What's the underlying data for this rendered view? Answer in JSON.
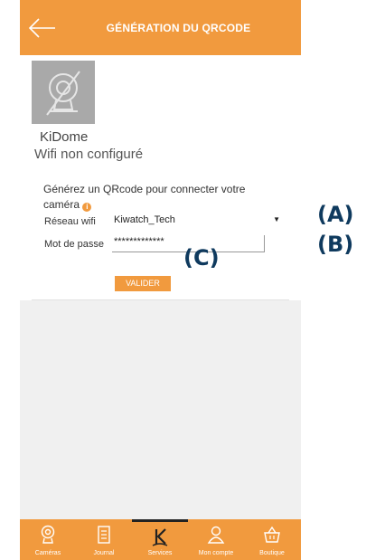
{
  "header": {
    "title": "GÉNÉRATION DU QRCODE"
  },
  "device": {
    "name": "KiDome",
    "status": "Wifi non configuré"
  },
  "form": {
    "prompt": "Générez un QRcode pour connecter votre caméra",
    "wifi_label": "Réseau wifi",
    "wifi_value": "Kiwatch_Tech",
    "password_label": "Mot de passe",
    "password_value": "*************",
    "validate_label": "VALIDER"
  },
  "tabs": [
    {
      "label": "Caméras",
      "icon": "camera-icon"
    },
    {
      "label": "Journal",
      "icon": "journal-icon"
    },
    {
      "label": "Services",
      "icon": "k-logo-icon"
    },
    {
      "label": "Mon compte",
      "icon": "account-icon"
    },
    {
      "label": "Boutique",
      "icon": "basket-icon"
    }
  ],
  "callouts": {
    "a": "(A)",
    "b": "(B)",
    "c": "(C)"
  },
  "colors": {
    "accent": "#f19a3e",
    "callout": "#0f3a5e"
  }
}
